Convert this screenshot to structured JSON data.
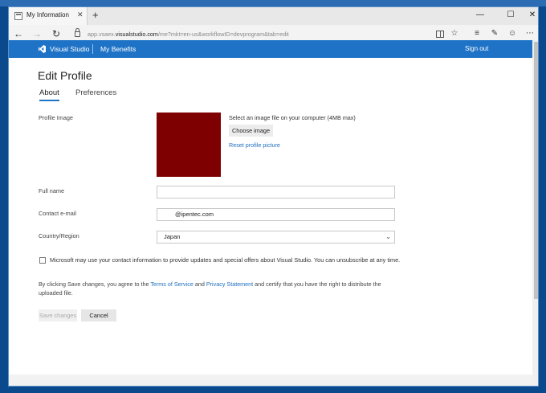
{
  "browser": {
    "tab_title": "My Information",
    "tab_close": "✕",
    "new_tab": "+",
    "url_prefix": "app.vsaex.",
    "url_domain": "visualstudio.com",
    "url_rest": "/me?mkt=en-us&workflowID=devprogram&tab=edit",
    "icons": [
      "back-arrow-icon",
      "forward-arrow-icon",
      "refresh-icon",
      "lock-icon",
      "reading-view-icon",
      "favorite-star-icon",
      "hub-icon",
      "web-note-icon",
      "share-icon",
      "more-icon"
    ]
  },
  "header": {
    "brand": "Visual Studio",
    "benefits": "My Benefits",
    "sign_out": "Sign out",
    "brand_color": "#1f73c7"
  },
  "page": {
    "title": "Edit Profile",
    "tabs": [
      {
        "label": "About",
        "active": true
      },
      {
        "label": "Preferences",
        "active": false
      }
    ]
  },
  "form": {
    "profile_image_label": "Profile Image",
    "image_instruction": "Select an image file on your computer (4MB max)",
    "choose_image": "Choose image",
    "reset_picture": "Reset profile picture",
    "avatar_color": "#7e0000",
    "full_name_label": "Full name",
    "full_name_value": "",
    "email_label": "Contact e-mail",
    "email_value": "@ipentec.com",
    "country_label": "Country/Region",
    "country_value": "Japan",
    "consent_text": "Microsoft may use your contact information to provide updates and special offers about Visual Studio. You can unsubscribe at any time.",
    "terms_pre": "By clicking Save changes, you agree to the ",
    "terms_link": "Terms of Service",
    "terms_and": " and ",
    "privacy_link": "Privacy Statement",
    "terms_post": " and certify that you have the right to distribute the uploaded file.",
    "save_label": "Save changes",
    "cancel_label": "Cancel"
  }
}
